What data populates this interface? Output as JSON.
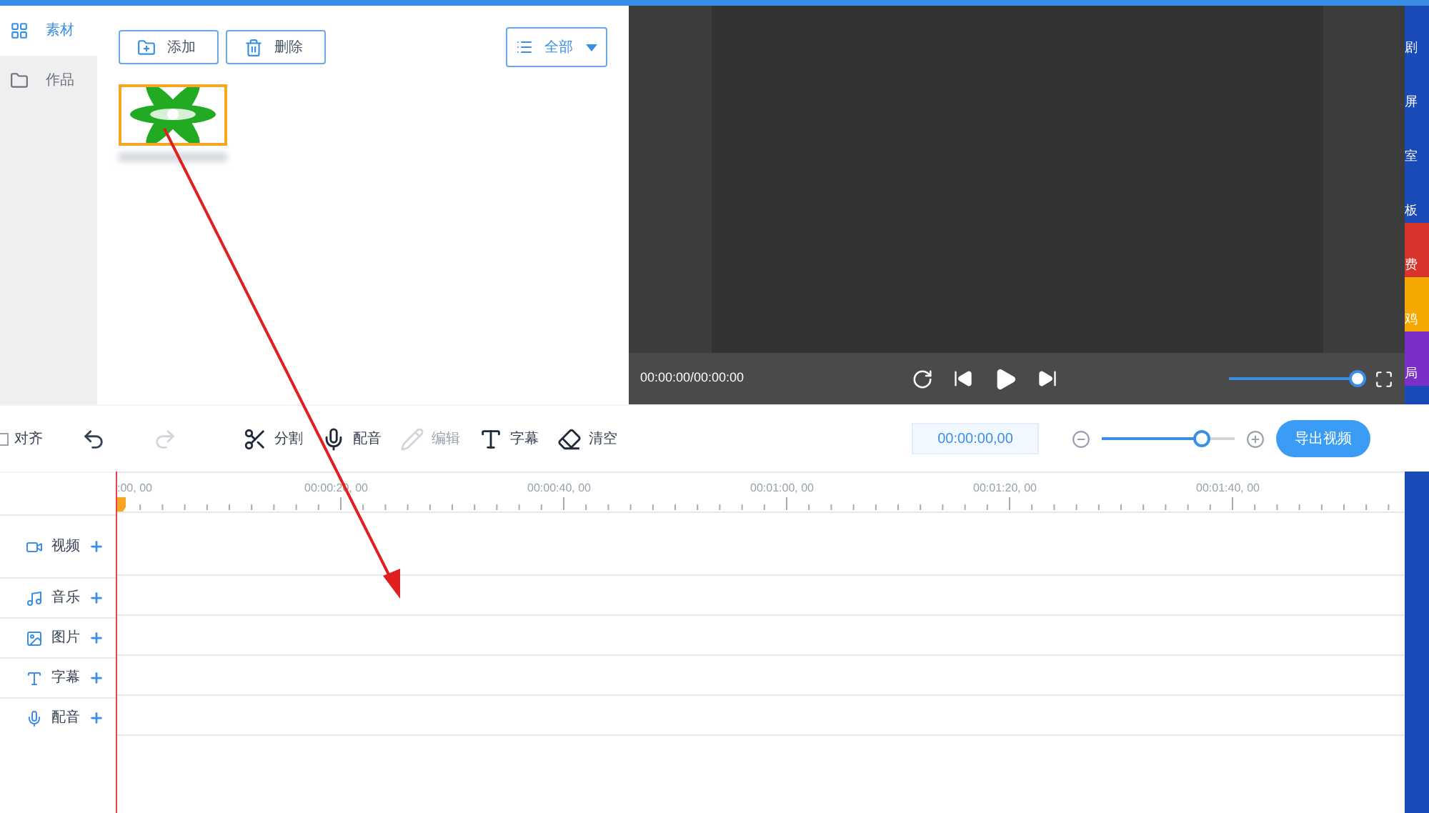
{
  "sidebar": {
    "items": [
      {
        "label": "素材",
        "selected": true
      },
      {
        "label": "作品",
        "selected": false
      }
    ]
  },
  "media_toolbar": {
    "buttons": [
      {
        "label": "添加"
      },
      {
        "label": "删除"
      }
    ],
    "filter": {
      "label": "全部"
    }
  },
  "media_items": [
    {
      "kind": "picture",
      "selected": true
    }
  ],
  "player": {
    "time": "00:00:00/00:00:00",
    "volume": {
      "level": 1
    }
  },
  "edit_toolbar": {
    "align": {
      "label": "对齐",
      "checked": false
    },
    "tools": [
      {
        "label": "分割",
        "disabled": false
      },
      {
        "label": "配音",
        "disabled": false
      },
      {
        "label": "编辑",
        "disabled": true
      },
      {
        "label": "字幕",
        "disabled": false
      },
      {
        "label": "清空",
        "disabled": false
      }
    ],
    "time": "00:00:00,00",
    "zoom": {
      "level": 0.75
    },
    "export": "导出视频"
  },
  "ruler": {
    "labels": [
      ":00, 00",
      "00:00:20, 00",
      "00:00:40, 00",
      "00:01:00, 00",
      "00:01:20, 00",
      "00:01:40, 00"
    ]
  },
  "tracks": [
    {
      "label": "视频"
    },
    {
      "label": "音乐"
    },
    {
      "label": "图片"
    },
    {
      "label": "字幕"
    },
    {
      "label": "配音"
    }
  ],
  "side_strip": [
    {
      "label": "剧",
      "color": "#1a4ab8"
    },
    {
      "label": "屏",
      "color": "#1a4ab8"
    },
    {
      "label": "室",
      "color": "#1a4ab8"
    },
    {
      "label": "板",
      "color": "#1a4ab8"
    },
    {
      "label": "费",
      "color": "#d9342b"
    },
    {
      "label": "鸡",
      "color": "#f5a800"
    },
    {
      "label": "局",
      "color": "#7b2fc9"
    }
  ]
}
